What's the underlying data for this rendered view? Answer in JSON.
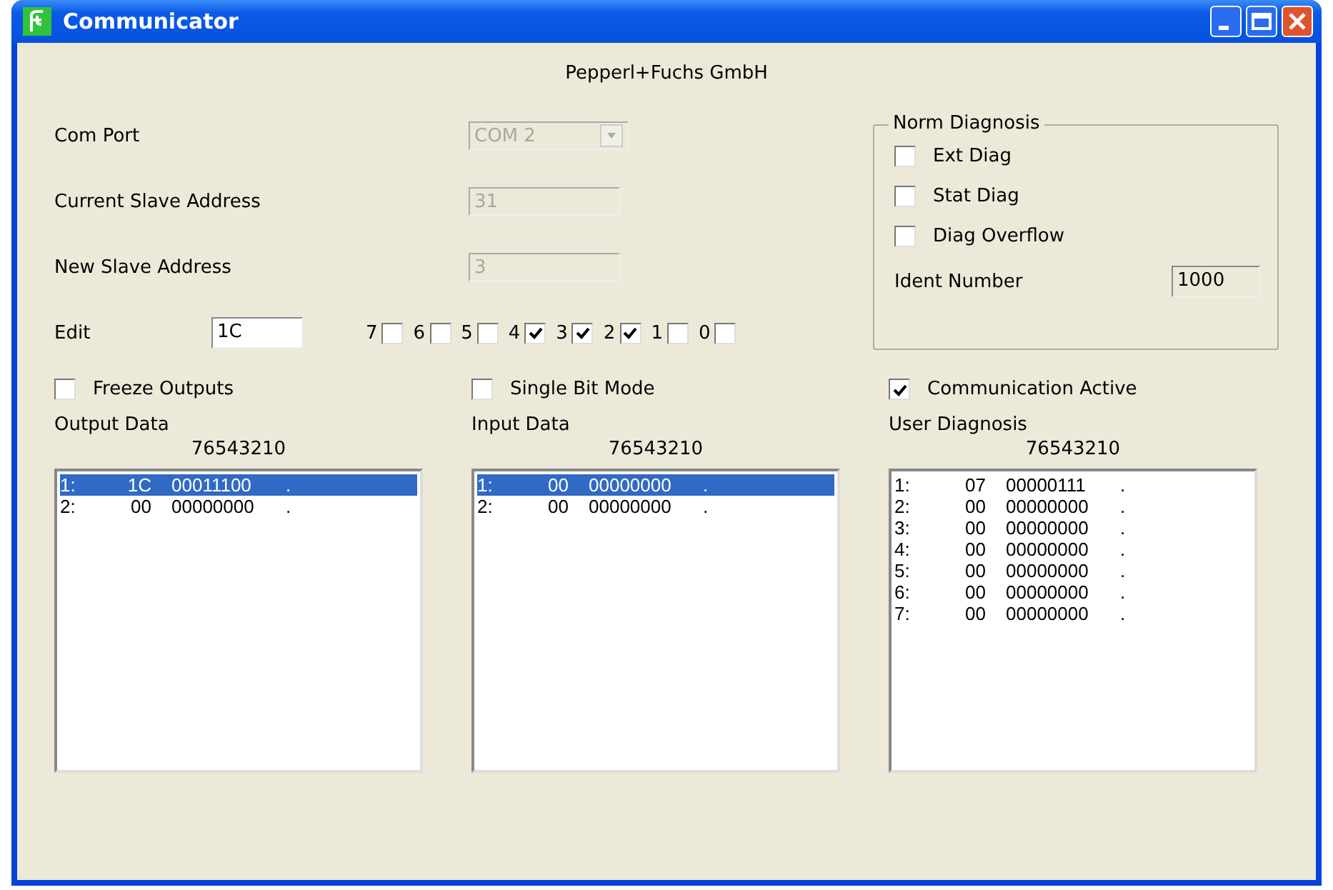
{
  "window": {
    "title": "Communicator"
  },
  "company": "Pepperl+Fuchs GmbH",
  "settings": [
    {
      "label": "Com Port",
      "kind": "dropdown",
      "value": "COM 2",
      "disabled": true
    },
    {
      "label": "Current Slave Address",
      "kind": "text",
      "value": "31",
      "disabled": true
    },
    {
      "label": "New Slave Address",
      "kind": "text",
      "value": "3",
      "disabled": true
    }
  ],
  "edit": {
    "label": "Edit",
    "value": "1C"
  },
  "bits": [
    {
      "label": "7",
      "checked": false
    },
    {
      "label": "6",
      "checked": false
    },
    {
      "label": "5",
      "checked": false
    },
    {
      "label": "4",
      "checked": true
    },
    {
      "label": "3",
      "checked": true
    },
    {
      "label": "2",
      "checked": true
    },
    {
      "label": "1",
      "checked": false
    },
    {
      "label": "0",
      "checked": false
    }
  ],
  "norm_diagnosis": {
    "title": "Norm Diagnosis",
    "items": [
      {
        "label": "Ext Diag",
        "checked": false
      },
      {
        "label": "Stat Diag",
        "checked": false
      },
      {
        "label": "Diag Overflow",
        "checked": false
      }
    ],
    "ident_label": "Ident Number",
    "ident_value": "1000"
  },
  "options": [
    {
      "label": "Freeze Outputs",
      "checked": false
    },
    {
      "label": "Single Bit Mode",
      "checked": false
    },
    {
      "label": "Communication Active",
      "checked": true
    }
  ],
  "lists": [
    {
      "title": "Output Data",
      "header": "76543210",
      "rows": [
        {
          "index": "1:",
          "hex": "1C",
          "binary": "00011100",
          "char": ".",
          "selected": true
        },
        {
          "index": "2:",
          "hex": "00",
          "binary": "00000000",
          "char": ".",
          "selected": false
        }
      ]
    },
    {
      "title": "Input Data",
      "header": "76543210",
      "rows": [
        {
          "index": "1:",
          "hex": "00",
          "binary": "00000000",
          "char": ".",
          "selected": true
        },
        {
          "index": "2:",
          "hex": "00",
          "binary": "00000000",
          "char": ".",
          "selected": false
        }
      ]
    },
    {
      "title": "User Diagnosis",
      "header": "76543210",
      "rows": [
        {
          "index": "1:",
          "hex": "07",
          "binary": "00000111",
          "char": ".",
          "selected": false
        },
        {
          "index": "2:",
          "hex": "00",
          "binary": "00000000",
          "char": ".",
          "selected": false
        },
        {
          "index": "3:",
          "hex": "00",
          "binary": "00000000",
          "char": ".",
          "selected": false
        },
        {
          "index": "4:",
          "hex": "00",
          "binary": "00000000",
          "char": ".",
          "selected": false
        },
        {
          "index": "5:",
          "hex": "00",
          "binary": "00000000",
          "char": ".",
          "selected": false
        },
        {
          "index": "6:",
          "hex": "00",
          "binary": "00000000",
          "char": ".",
          "selected": false
        },
        {
          "index": "7:",
          "hex": "00",
          "binary": "00000000",
          "char": ".",
          "selected": false
        }
      ]
    }
  ]
}
